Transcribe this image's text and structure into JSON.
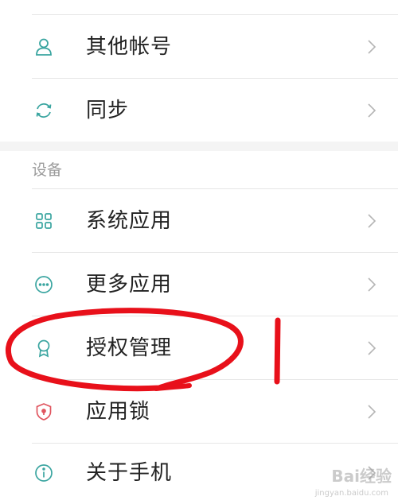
{
  "settings": {
    "items_top": [
      {
        "label": "其他帐号",
        "icon": "person-icon"
      },
      {
        "label": "同步",
        "icon": "sync-icon"
      }
    ],
    "section_header": "设备",
    "items_device": [
      {
        "label": "系统应用",
        "icon": "grid-icon"
      },
      {
        "label": "更多应用",
        "icon": "more-icon"
      },
      {
        "label": "授权管理",
        "icon": "badge-icon"
      },
      {
        "label": "应用锁",
        "icon": "shield-lock-icon"
      },
      {
        "label": "关于手机",
        "icon": "info-icon"
      }
    ]
  },
  "colors": {
    "icon_teal": "#3aa5a0",
    "icon_red": "#e0555f",
    "annotation_red": "#e8101a"
  },
  "watermark": {
    "text": "Bai经验",
    "sub": "jingyan.baidu.com"
  }
}
